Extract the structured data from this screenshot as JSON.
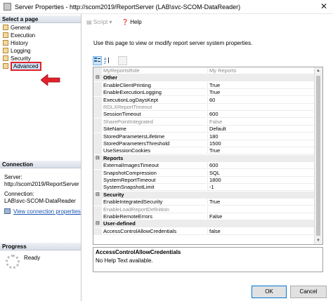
{
  "window": {
    "title": "Server Properties - http://scom2019/ReportServer (LAB\\svc-SCOM-DataReader)"
  },
  "left_pane": {
    "select_page_header": "Select a page",
    "pages": [
      {
        "label": "General"
      },
      {
        "label": "Execution"
      },
      {
        "label": "History"
      },
      {
        "label": "Logging"
      },
      {
        "label": "Security"
      },
      {
        "label": "Advanced"
      }
    ],
    "connection_header": "Connection",
    "server_label": "Server:",
    "server_value": "http://scom2019/ReportServer",
    "connection_label": "Connection:",
    "connection_value": "LAB\\svc-SCOM-DataReader",
    "view_connection_link": "View connection properties",
    "progress_header": "Progress",
    "progress_status": "Ready"
  },
  "toolbar": {
    "script_label": "Script",
    "help_label": "Help"
  },
  "description": "Use this page to view or modify report server system properties.",
  "grid": {
    "rows": [
      {
        "type": "prop",
        "name": "MyReportsRole",
        "value": "My Reports",
        "readonly": true
      },
      {
        "type": "cat",
        "name": "Other"
      },
      {
        "type": "prop",
        "name": "EnableClientPrinting",
        "value": "True"
      },
      {
        "type": "prop",
        "name": "EnableExecutionLogging",
        "value": "True"
      },
      {
        "type": "prop",
        "name": "ExecutionLogDaysKept",
        "value": "60"
      },
      {
        "type": "prop",
        "name": "RDLXReportTimeout",
        "value": "",
        "readonly": true
      },
      {
        "type": "prop",
        "name": "SessionTimeout",
        "value": "600"
      },
      {
        "type": "prop",
        "name": "SharePointIntegrated",
        "value": "False",
        "readonly": true
      },
      {
        "type": "prop",
        "name": "SiteName",
        "value": "Default"
      },
      {
        "type": "prop",
        "name": "StoredParametersLifetime",
        "value": "180"
      },
      {
        "type": "prop",
        "name": "StoredParametersThreshold",
        "value": "1500"
      },
      {
        "type": "prop",
        "name": "UseSessionCookies",
        "value": "True"
      },
      {
        "type": "cat",
        "name": "Reports"
      },
      {
        "type": "prop",
        "name": "ExternalImagesTimeout",
        "value": "600"
      },
      {
        "type": "prop",
        "name": "SnapshotCompression",
        "value": "SQL"
      },
      {
        "type": "prop",
        "name": "SystemReportTimeout",
        "value": "1800"
      },
      {
        "type": "prop",
        "name": "SystemSnapshotLimit",
        "value": "-1"
      },
      {
        "type": "cat",
        "name": "Security"
      },
      {
        "type": "prop",
        "name": "EnableIntegratedSecurity",
        "value": "True"
      },
      {
        "type": "prop",
        "name": "EnableLoadReportDefinition",
        "value": "",
        "readonly": true
      },
      {
        "type": "prop",
        "name": "EnableRemoteErrors",
        "value": "False"
      },
      {
        "type": "cat",
        "name": "User-defined"
      },
      {
        "type": "prop",
        "name": "AccessControlAllowCredentials",
        "value": "false"
      }
    ]
  },
  "help_panel": {
    "title": "AccessControlAllowCredentials",
    "text": "No Help Text available."
  },
  "buttons": {
    "ok": "OK",
    "cancel": "Cancel"
  },
  "colors": {
    "highlight_border": "#e0212b",
    "arrow": "#e0212b",
    "link": "#1a53b3"
  }
}
